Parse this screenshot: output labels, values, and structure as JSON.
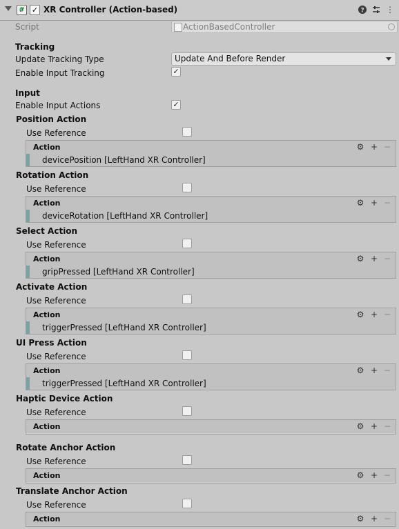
{
  "header": {
    "title": "XR Controller (Action-based)",
    "component_icon": "#",
    "icons": [
      "help-icon",
      "presets-icon",
      "more-icon"
    ]
  },
  "script": {
    "label": "Script",
    "value": "ActionBasedController"
  },
  "tracking": {
    "section": "Tracking",
    "update_type_label": "Update Tracking Type",
    "update_type_value": "Update And Before Render",
    "enable_tracking_label": "Enable Input Tracking",
    "enable_tracking_checked": true
  },
  "input": {
    "section": "Input",
    "enable_actions_label": "Enable Input Actions",
    "enable_actions_checked": true
  },
  "common": {
    "use_reference": "Use Reference",
    "action_header": "Action"
  },
  "actions": [
    {
      "title": "Position Action",
      "binding": "devicePosition [LeftHand XR Controller]"
    },
    {
      "title": "Rotation Action",
      "binding": "deviceRotation [LeftHand XR Controller]"
    },
    {
      "title": "Select Action",
      "binding": "gripPressed [LeftHand XR Controller]"
    },
    {
      "title": "Activate Action",
      "binding": "triggerPressed [LeftHand XR Controller]"
    },
    {
      "title": "UI Press Action",
      "binding": "triggerPressed [LeftHand XR Controller]"
    },
    {
      "title": "Haptic Device Action",
      "binding": ""
    },
    {
      "title": "Rotate Anchor Action",
      "binding": ""
    },
    {
      "title": "Translate Anchor Action",
      "binding": ""
    }
  ],
  "colors": {
    "background": "#c8c8c8",
    "binding_bar": "#7aa3a4"
  }
}
